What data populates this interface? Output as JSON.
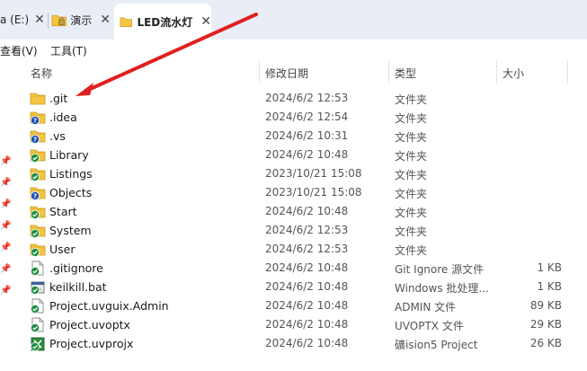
{
  "tabs": [
    {
      "label": "a (E:)",
      "close": "✕"
    },
    {
      "label": "演示",
      "close": "✕"
    },
    {
      "label": "LED流水灯",
      "close": "✕"
    }
  ],
  "menu": {
    "view": "查看(V)",
    "tools": "工具(T)"
  },
  "columns": {
    "name": "名称",
    "date": "修改日期",
    "type": "类型",
    "size": "大小"
  },
  "colors": {
    "folder": "#f4c542",
    "status_ok": "#1e8e3e",
    "status_unknown": "#1a4fb5",
    "arrow": "#e02020"
  },
  "files": [
    {
      "name": ".git",
      "date": "2024/6/2 12:53",
      "type": "文件夹",
      "size": "",
      "icon": "folder-icon",
      "badge": "none"
    },
    {
      "name": ".idea",
      "date": "2024/6/2 12:54",
      "type": "文件夹",
      "size": "",
      "icon": "folder-icon",
      "badge": "question"
    },
    {
      "name": ".vs",
      "date": "2024/6/2 10:31",
      "type": "文件夹",
      "size": "",
      "icon": "folder-icon",
      "badge": "question"
    },
    {
      "name": "Library",
      "date": "2024/6/2 10:48",
      "type": "文件夹",
      "size": "",
      "icon": "folder-icon",
      "badge": "check"
    },
    {
      "name": "Listings",
      "date": "2023/10/21 15:08",
      "type": "文件夹",
      "size": "",
      "icon": "folder-icon",
      "badge": "check"
    },
    {
      "name": "Objects",
      "date": "2023/10/21 15:08",
      "type": "文件夹",
      "size": "",
      "icon": "folder-icon",
      "badge": "question"
    },
    {
      "name": "Start",
      "date": "2024/6/2 10:48",
      "type": "文件夹",
      "size": "",
      "icon": "folder-icon",
      "badge": "check"
    },
    {
      "name": "System",
      "date": "2024/6/2 12:53",
      "type": "文件夹",
      "size": "",
      "icon": "folder-icon",
      "badge": "check"
    },
    {
      "name": "User",
      "date": "2024/6/2 12:53",
      "type": "文件夹",
      "size": "",
      "icon": "folder-icon",
      "badge": "check"
    },
    {
      "name": ".gitignore",
      "date": "2024/6/2 10:48",
      "type": "Git Ignore 源文件",
      "size": "1 KB",
      "icon": "file-icon",
      "badge": "check"
    },
    {
      "name": "keilkill.bat",
      "date": "2024/6/2 10:48",
      "type": "Windows 批处理...",
      "size": "1 KB",
      "icon": "bat-file-icon",
      "badge": "check"
    },
    {
      "name": "Project.uvguix.Admin",
      "date": "2024/6/2 10:48",
      "type": "ADMIN 文件",
      "size": "89 KB",
      "icon": "file-icon",
      "badge": "check"
    },
    {
      "name": "Project.uvoptx",
      "date": "2024/6/2 10:48",
      "type": "UVOPTX 文件",
      "size": "29 KB",
      "icon": "file-icon",
      "badge": "check"
    },
    {
      "name": "Project.uvprojx",
      "date": "2024/6/2 10:48",
      "type": "礦ision5 Project",
      "size": "26 KB",
      "icon": "keil-project-icon",
      "badge": "check"
    }
  ]
}
